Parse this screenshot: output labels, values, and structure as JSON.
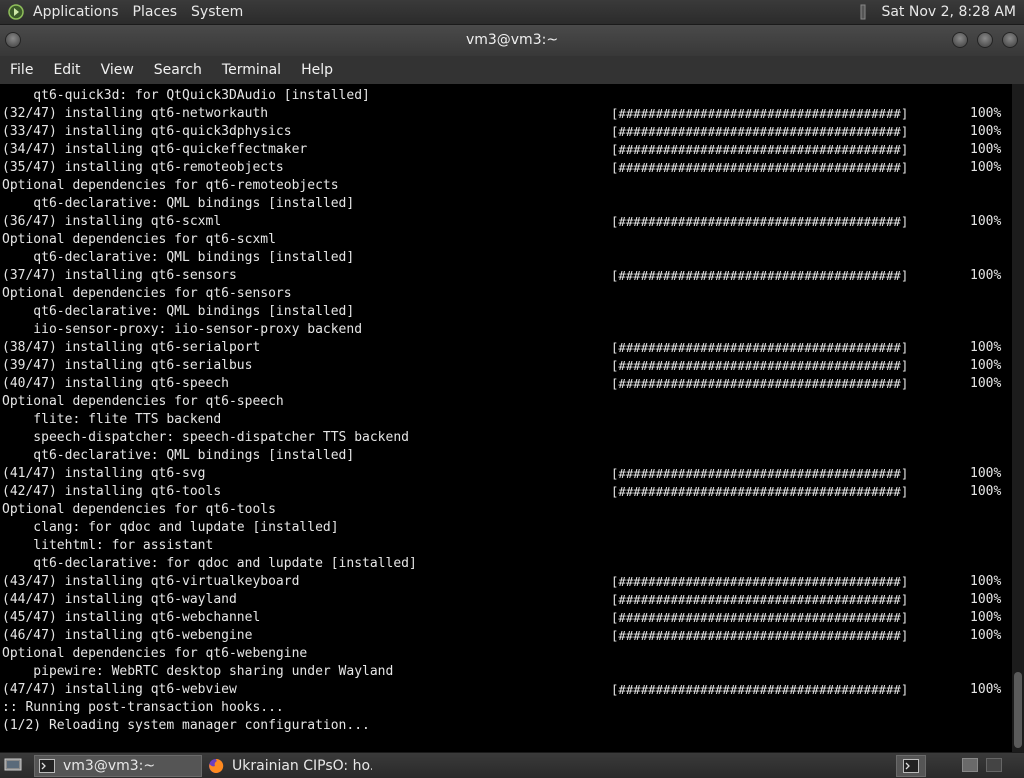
{
  "top_panel": {
    "menus": [
      "Applications",
      "Places",
      "System"
    ],
    "clock": "Sat Nov 2,  8:28 AM"
  },
  "window": {
    "title": "vm3@vm3:~"
  },
  "menubar": [
    "File",
    "Edit",
    "View",
    "Search",
    "Terminal",
    "Help"
  ],
  "terminal": {
    "progress_bar": "[######################################]",
    "progress_percent": "100%",
    "lines": [
      {
        "text": "    qt6-quick3d: for QtQuick3DAudio [installed]",
        "progress": false
      },
      {
        "text": "(32/47) installing qt6-networkauth",
        "progress": true
      },
      {
        "text": "(33/47) installing qt6-quick3dphysics",
        "progress": true
      },
      {
        "text": "(34/47) installing qt6-quickeffectmaker",
        "progress": true
      },
      {
        "text": "(35/47) installing qt6-remoteobjects",
        "progress": true
      },
      {
        "text": "Optional dependencies for qt6-remoteobjects",
        "progress": false
      },
      {
        "text": "    qt6-declarative: QML bindings [installed]",
        "progress": false
      },
      {
        "text": "(36/47) installing qt6-scxml",
        "progress": true
      },
      {
        "text": "Optional dependencies for qt6-scxml",
        "progress": false
      },
      {
        "text": "    qt6-declarative: QML bindings [installed]",
        "progress": false
      },
      {
        "text": "(37/47) installing qt6-sensors",
        "progress": true
      },
      {
        "text": "Optional dependencies for qt6-sensors",
        "progress": false
      },
      {
        "text": "    qt6-declarative: QML bindings [installed]",
        "progress": false
      },
      {
        "text": "    iio-sensor-proxy: iio-sensor-proxy backend",
        "progress": false
      },
      {
        "text": "(38/47) installing qt6-serialport",
        "progress": true
      },
      {
        "text": "(39/47) installing qt6-serialbus",
        "progress": true
      },
      {
        "text": "(40/47) installing qt6-speech",
        "progress": true
      },
      {
        "text": "Optional dependencies for qt6-speech",
        "progress": false
      },
      {
        "text": "    flite: flite TTS backend",
        "progress": false
      },
      {
        "text": "    speech-dispatcher: speech-dispatcher TTS backend",
        "progress": false
      },
      {
        "text": "    qt6-declarative: QML bindings [installed]",
        "progress": false
      },
      {
        "text": "(41/47) installing qt6-svg",
        "progress": true
      },
      {
        "text": "(42/47) installing qt6-tools",
        "progress": true
      },
      {
        "text": "Optional dependencies for qt6-tools",
        "progress": false
      },
      {
        "text": "    clang: for qdoc and lupdate [installed]",
        "progress": false
      },
      {
        "text": "    litehtml: for assistant",
        "progress": false
      },
      {
        "text": "    qt6-declarative: for qdoc and lupdate [installed]",
        "progress": false
      },
      {
        "text": "(43/47) installing qt6-virtualkeyboard",
        "progress": true
      },
      {
        "text": "(44/47) installing qt6-wayland",
        "progress": true
      },
      {
        "text": "(45/47) installing qt6-webchannel",
        "progress": true
      },
      {
        "text": "(46/47) installing qt6-webengine",
        "progress": true
      },
      {
        "text": "Optional dependencies for qt6-webengine",
        "progress": false
      },
      {
        "text": "    pipewire: WebRTC desktop sharing under Wayland",
        "progress": false
      },
      {
        "text": "(47/47) installing qt6-webview",
        "progress": true
      },
      {
        "text": ":: Running post-transaction hooks...",
        "progress": false
      },
      {
        "text": "(1/2) Reloading system manager configuration...",
        "progress": false
      }
    ]
  },
  "taskbar": {
    "tasks": [
      {
        "label": "vm3@vm3:~",
        "icon": "terminal-icon"
      },
      {
        "label": "Ukrainian CIPsO: ho...",
        "icon": "firefox-icon"
      }
    ]
  },
  "colors": {
    "terminal_bg": "#000000",
    "terminal_fg": "#e6e6e6",
    "panel_bg": "#333333"
  }
}
